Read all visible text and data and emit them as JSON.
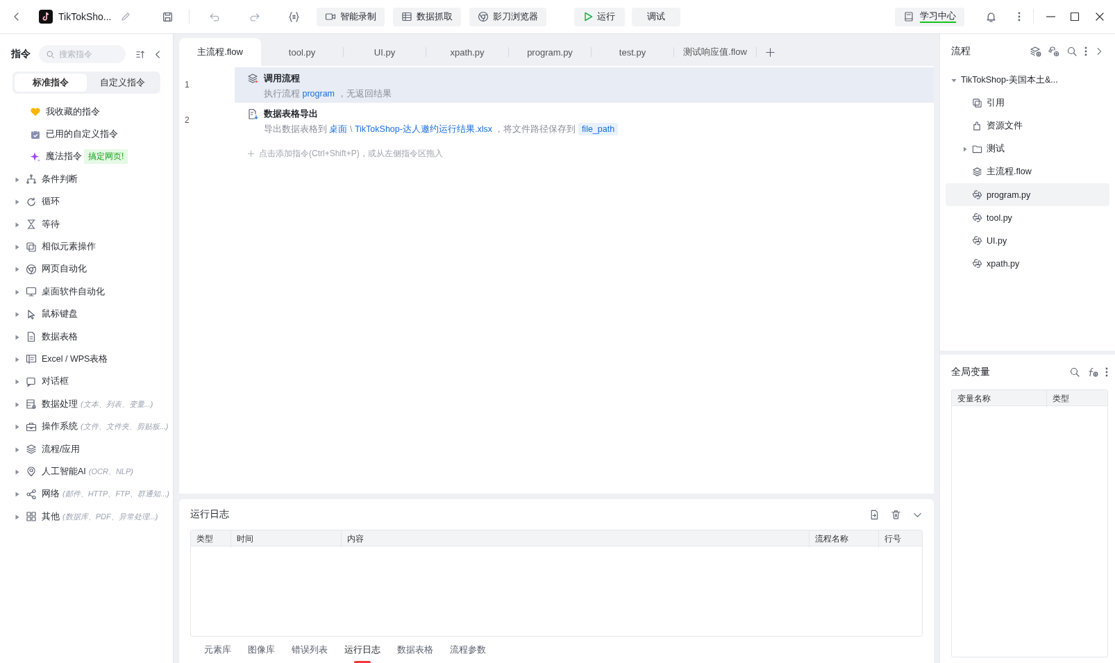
{
  "titlebar": {
    "title": "TikTokSho...",
    "tools": [
      {
        "label": "智能录制"
      },
      {
        "label": "数据抓取"
      },
      {
        "label": "影刀浏览器"
      }
    ],
    "run_button": "运行",
    "debug_button": "调试",
    "learning_center": "学习中心"
  },
  "sidebar": {
    "title": "指令",
    "search": {
      "placeholder": "搜索指令"
    },
    "tabs": [
      {
        "label": "标准指令",
        "selected": true
      },
      {
        "label": "自定义指令",
        "selected": false
      }
    ],
    "items": [
      {
        "kind": "shortcut",
        "label": "我收藏的指令"
      },
      {
        "kind": "shortcut",
        "label": "已用的自定义指令"
      },
      {
        "kind": "shortcut",
        "label": "魔法指令",
        "badge": "搞定网页!"
      },
      {
        "kind": "group",
        "label": "条件判断"
      },
      {
        "kind": "group",
        "label": "循环"
      },
      {
        "kind": "group",
        "label": "等待"
      },
      {
        "kind": "group",
        "label": "相似元素操作"
      },
      {
        "kind": "group",
        "label": "网页自动化"
      },
      {
        "kind": "group",
        "label": "桌面软件自动化"
      },
      {
        "kind": "group",
        "label": "鼠标键盘"
      },
      {
        "kind": "group",
        "label": "数据表格"
      },
      {
        "kind": "group",
        "label": "Excel / WPS表格"
      },
      {
        "kind": "group",
        "label": "对话框"
      },
      {
        "kind": "group",
        "label": "数据处理",
        "hint": "(文本、列表、变量...)"
      },
      {
        "kind": "group",
        "label": "操作系统",
        "hint": "(文件、文件夹、剪贴板...)"
      },
      {
        "kind": "group",
        "label": "流程/应用"
      },
      {
        "kind": "group",
        "label": "人工智能AI",
        "hint": "(OCR、NLP)"
      },
      {
        "kind": "group",
        "label": "网络",
        "hint": "(邮件、HTTP、FTP、群通知...)"
      },
      {
        "kind": "group",
        "label": "其他",
        "hint": "(数据库、PDF、异常处理...)"
      }
    ]
  },
  "editor": {
    "tabs": [
      {
        "label": "主流程.flow",
        "selected": true
      },
      {
        "label": "tool.py",
        "selected": false
      },
      {
        "label": "UI.py",
        "selected": false
      },
      {
        "label": "xpath.py",
        "selected": false
      },
      {
        "label": "program.py",
        "selected": false
      },
      {
        "label": "test.py",
        "selected": false
      },
      {
        "label": "测试响应值.flow",
        "selected": false
      }
    ],
    "lines": [
      {
        "number": "1",
        "kind": "call",
        "title": "调用流程",
        "selected": true,
        "parts": [
          {
            "kind": "text",
            "text": "执行流程 "
          },
          {
            "kind": "link",
            "text": "program"
          },
          {
            "kind": "text",
            "text": " ，无返回结果"
          }
        ]
      },
      {
        "number": "2",
        "kind": "export",
        "title": "数据表格导出",
        "selected": false,
        "parts": [
          {
            "kind": "text",
            "text": "导出数据表格到 "
          },
          {
            "kind": "link",
            "text": "桌面"
          },
          {
            "kind": "text",
            "text": " \\ "
          },
          {
            "kind": "link",
            "text": "TikTokShop-达人邀约运行结果.xlsx"
          },
          {
            "kind": "text",
            "text": " ，将文件路径保存到 "
          },
          {
            "kind": "var",
            "text": "file_path"
          }
        ]
      }
    ],
    "add_hint": "点击添加指令(Ctrl+Shift+P)，或从左侧指令区拖入"
  },
  "log": {
    "title": "运行日志",
    "columns": [
      "类型",
      "时间",
      "内容",
      "流程名称",
      "行号"
    ],
    "tabs": [
      {
        "label": "元素库",
        "selected": false
      },
      {
        "label": "图像库",
        "selected": false
      },
      {
        "label": "错误列表",
        "selected": false
      },
      {
        "label": "运行日志",
        "selected": true
      },
      {
        "label": "数据表格",
        "selected": false
      },
      {
        "label": "流程参数",
        "selected": false
      }
    ]
  },
  "flow_panel": {
    "title": "流程",
    "tree": [
      {
        "kind": "project",
        "label": "TikTokShop-美国本土&...",
        "expanded": true,
        "selected": false,
        "children": [
          {
            "kind": "reference",
            "label": "引用",
            "selected": false
          },
          {
            "kind": "resource",
            "label": "资源文件",
            "selected": false
          },
          {
            "kind": "folder",
            "label": "测试",
            "expanded": false,
            "selected": false
          },
          {
            "kind": "flow",
            "label": "主流程.flow",
            "selected": false
          },
          {
            "kind": "script",
            "label": "program.py",
            "selected": true
          },
          {
            "kind": "script",
            "label": "tool.py",
            "selected": false
          },
          {
            "kind": "script",
            "label": "UI.py",
            "selected": false
          },
          {
            "kind": "script",
            "label": "xpath.py",
            "selected": false
          }
        ]
      }
    ]
  },
  "variables": {
    "title": "全局变量",
    "columns": [
      "变量名称",
      "类型"
    ]
  }
}
